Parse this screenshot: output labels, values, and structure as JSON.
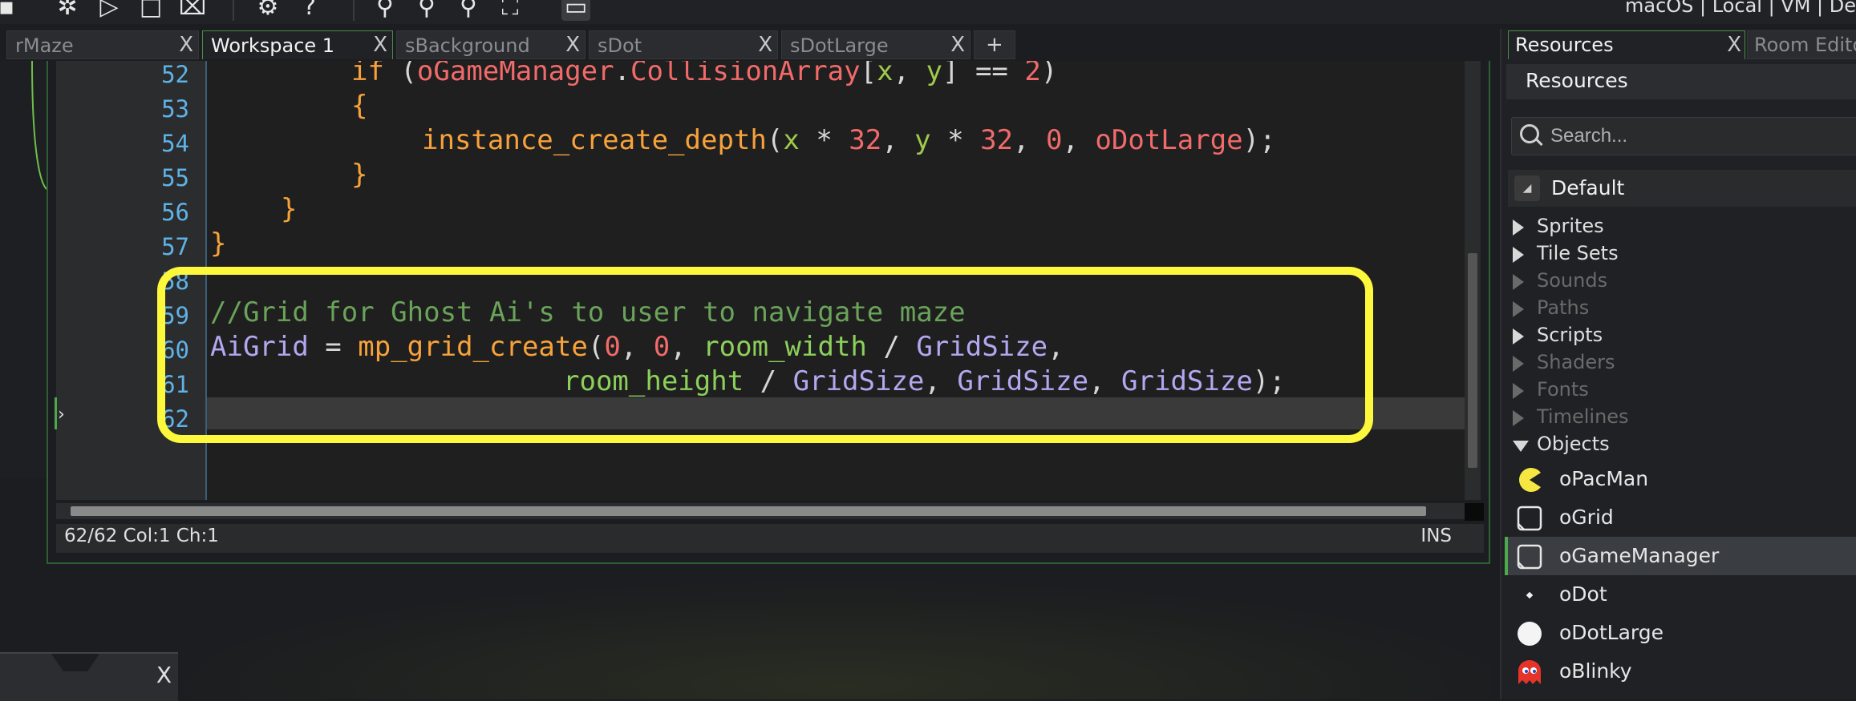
{
  "toolbar": {
    "target_text": "macOS | Local | VM | De"
  },
  "tabs": [
    {
      "label": "rMaze",
      "close": "X"
    },
    {
      "label": "Workspace 1",
      "close": "X"
    },
    {
      "label": "sBackground",
      "close": "X"
    },
    {
      "label": "sDot",
      "close": "X"
    },
    {
      "label": "sDotLarge",
      "close": "X"
    },
    {
      "label": "+"
    }
  ],
  "editor": {
    "line_numbers": [
      "52",
      "53",
      "54",
      "55",
      "56",
      "57",
      "58",
      "59",
      "60",
      "61",
      "62"
    ],
    "code": {
      "l52_kw": "if",
      "l52_a": " (",
      "l52_obj": "oGameManager",
      "l52_b": ".",
      "l52_c": "CollisionArray",
      "l52_d": "[",
      "l52_x": "x",
      "l52_e": ", ",
      "l52_y": "y",
      "l52_f": "] == ",
      "l52_n": "2",
      "l52_g": ")",
      "l53": "{",
      "l54_fn": "instance_create_depth",
      "l54_a": "(",
      "l54_x": "x",
      "l54_b": " * ",
      "l54_n1": "32",
      "l54_c": ", ",
      "l54_y": "y",
      "l54_d": " * ",
      "l54_n2": "32",
      "l54_e": ", ",
      "l54_n3": "0",
      "l54_f": ", ",
      "l54_obj": "oDotLarge",
      "l54_g": ");",
      "l55": "}",
      "l56": "}",
      "l57": "}",
      "l59_comment": "//Grid for Ghost Ai's to user to navigate maze",
      "l60_var": "AiGrid",
      "l60_a": " = ",
      "l60_fn": "mp_grid_create",
      "l60_b": "(",
      "l60_n1": "0",
      "l60_c": ", ",
      "l60_n2": "0",
      "l60_d": ", ",
      "l60_bi": "room_width",
      "l60_e": " / ",
      "l60_gs": "GridSize",
      "l60_f": ",",
      "l61_bi": "room_height",
      "l61_a": " / ",
      "l61_gs1": "GridSize",
      "l61_b": ", ",
      "l61_gs2": "GridSize",
      "l61_c": ", ",
      "l61_gs3": "GridSize",
      "l61_d": ");"
    }
  },
  "status": {
    "position": "62/62 Col:1 Ch:1",
    "mode": "INS"
  },
  "float_panel": {
    "close": "X"
  },
  "resources": {
    "tab_label": "Resources",
    "tab_close": "X",
    "tab2_label": "Room Editor",
    "header": "Resources",
    "search_placeholder": "Search...",
    "default_label": "Default",
    "groups": [
      {
        "label": "Sprites"
      },
      {
        "label": "Tile Sets"
      },
      {
        "label": "Sounds"
      },
      {
        "label": "Paths"
      },
      {
        "label": "Scripts"
      },
      {
        "label": "Shaders"
      },
      {
        "label": "Fonts"
      },
      {
        "label": "Timelines"
      },
      {
        "label": "Objects"
      }
    ],
    "objects": [
      {
        "label": "oPacMan",
        "icon": "pacman-icon"
      },
      {
        "label": "oGrid",
        "icon": "object-icon"
      },
      {
        "label": "oGameManager",
        "icon": "object-icon"
      },
      {
        "label": "oDot",
        "icon": "dot-icon"
      },
      {
        "label": "oDotLarge",
        "icon": "large-dot-icon"
      },
      {
        "label": "oBlinky",
        "icon": "ghost-icon"
      }
    ],
    "highlight_color": "#fef83d"
  }
}
